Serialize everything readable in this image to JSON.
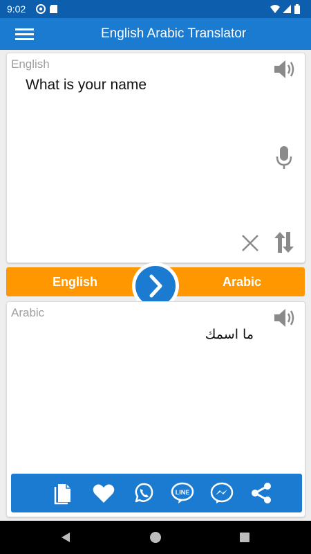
{
  "status_bar": {
    "time": "9:02",
    "icons": [
      "at-sign-icon",
      "sd-card-icon",
      "wifi-icon",
      "signal-icon",
      "battery-icon"
    ]
  },
  "app_bar": {
    "title": "English Arabic Translator",
    "menu_icon": "hamburger-menu-icon"
  },
  "input_panel": {
    "language_label": "English",
    "text": "What is your name",
    "icons": [
      "speaker-icon",
      "microphone-icon",
      "clear-icon",
      "swap-vertical-icon"
    ]
  },
  "language_bar": {
    "source_language": "English",
    "target_language": "Arabic",
    "translate_icon": "chevron-right-icon"
  },
  "output_panel": {
    "language_label": "Arabic",
    "text": "ما اسمك",
    "icons": [
      "speaker-icon"
    ]
  },
  "action_bar": {
    "icons": [
      "copy-icon",
      "favorite-heart-icon",
      "whatsapp-icon",
      "line-icon",
      "messenger-icon",
      "share-icon"
    ]
  },
  "nav_bar": {
    "icons": [
      "back-icon",
      "home-icon",
      "recents-icon"
    ]
  },
  "colors": {
    "primary": "#1a7bd1",
    "status_bar": "#0d5fae",
    "accent": "#ff9700",
    "icon_gray": "#8a8a8a"
  }
}
